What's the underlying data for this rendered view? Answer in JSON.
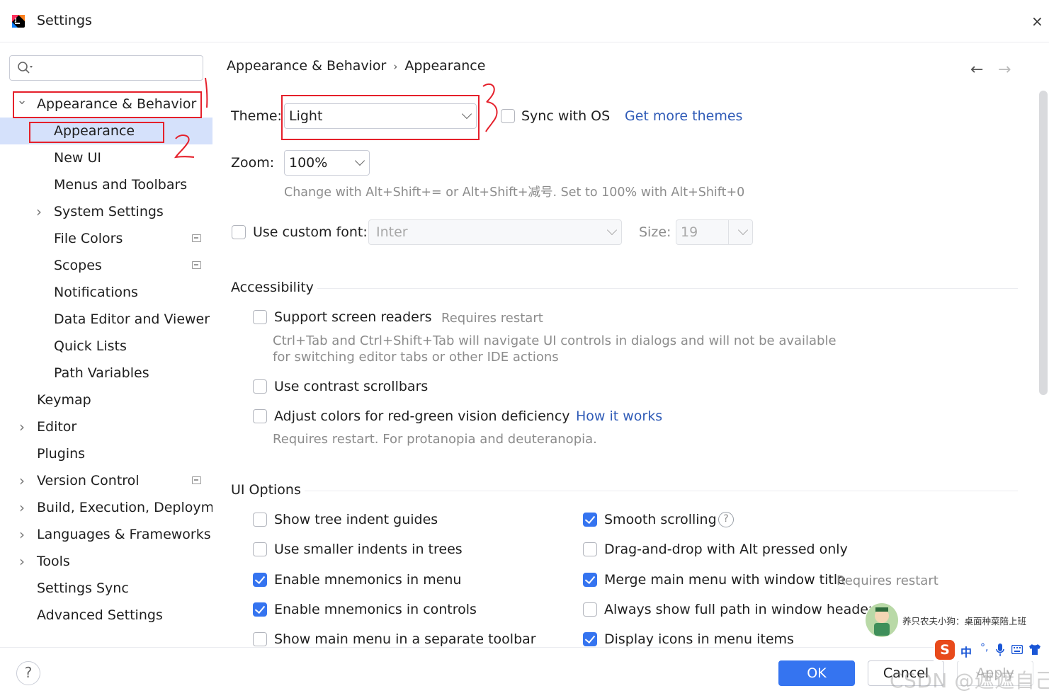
{
  "window": {
    "title": "Settings",
    "close_glyph": "×"
  },
  "sidebar": {
    "search_placeholder": "",
    "items": [
      {
        "label": "Appearance & Behavior",
        "level": 0,
        "expandable": true,
        "expanded": true
      },
      {
        "label": "Appearance",
        "level": 1,
        "selected": true
      },
      {
        "label": "New UI",
        "level": 1
      },
      {
        "label": "Menus and Toolbars",
        "level": 1
      },
      {
        "label": "System Settings",
        "level": 1,
        "expandable": true
      },
      {
        "label": "File Colors",
        "level": 1,
        "badge": true
      },
      {
        "label": "Scopes",
        "level": 1,
        "badge": true
      },
      {
        "label": "Notifications",
        "level": 1
      },
      {
        "label": "Data Editor and Viewer",
        "level": 1
      },
      {
        "label": "Quick Lists",
        "level": 1
      },
      {
        "label": "Path Variables",
        "level": 1
      },
      {
        "label": "Keymap",
        "level": 0
      },
      {
        "label": "Editor",
        "level": 0,
        "expandable": true
      },
      {
        "label": "Plugins",
        "level": 0
      },
      {
        "label": "Version Control",
        "level": 0,
        "expandable": true,
        "badge": true
      },
      {
        "label": "Build, Execution, Deployment",
        "level": 0,
        "expandable": true
      },
      {
        "label": "Languages & Frameworks",
        "level": 0,
        "expandable": true
      },
      {
        "label": "Tools",
        "level": 0,
        "expandable": true
      },
      {
        "label": "Settings Sync",
        "level": 0
      },
      {
        "label": "Advanced Settings",
        "level": 0
      }
    ]
  },
  "breadcrumb": {
    "parent": "Appearance & Behavior",
    "separator": "›",
    "current": "Appearance"
  },
  "nav": {
    "back": "←",
    "forward": "→"
  },
  "theme": {
    "label": "Theme:",
    "value": "Light",
    "sync_label": "Sync with OS",
    "sync_checked": false,
    "more_link": "Get more themes"
  },
  "zoom": {
    "label": "Zoom:",
    "value": "100%",
    "hint": "Change with Alt+Shift+= or Alt+Shift+减号. Set to 100% with Alt+Shift+0"
  },
  "font": {
    "checkbox_label": "Use custom font:",
    "checked": false,
    "font_value": "Inter",
    "size_label": "Size:",
    "size_value": "19"
  },
  "accessibility": {
    "title": "Accessibility",
    "screen_readers": {
      "label": "Support screen readers",
      "note": "Requires restart",
      "checked": false,
      "desc_line1": "Ctrl+Tab and Ctrl+Shift+Tab will navigate UI controls in dialogs and will not be available",
      "desc_line2": "for switching editor tabs or other IDE actions"
    },
    "contrast": {
      "label": "Use contrast scrollbars",
      "checked": false
    },
    "color_deficiency": {
      "label": "Adjust colors for red-green vision deficiency",
      "link": "How it works",
      "checked": false,
      "desc": "Requires restart. For protanopia and deuteranopia."
    }
  },
  "ui_options": {
    "title": "UI Options",
    "left": [
      {
        "label": "Show tree indent guides",
        "checked": false
      },
      {
        "label": "Use smaller indents in trees",
        "checked": false
      },
      {
        "label": "Enable mnemonics in menu",
        "checked": true
      },
      {
        "label": "Enable mnemonics in controls",
        "checked": true
      },
      {
        "label": "Show main menu in a separate toolbar",
        "checked": false
      }
    ],
    "right": [
      {
        "label": "Smooth scrolling",
        "checked": true,
        "help": "?"
      },
      {
        "label": "Drag-and-drop with Alt pressed only",
        "checked": false
      },
      {
        "label": "Merge main menu with window title",
        "checked": true,
        "note": "Requires restart"
      },
      {
        "label": "Always show full path in window header",
        "checked": false
      },
      {
        "label": "Display icons in menu items",
        "checked": true
      }
    ]
  },
  "footer": {
    "help": "?",
    "ok": "OK",
    "cancel": "Cancel",
    "apply": "Apply"
  },
  "overlay": {
    "chat_text": "养只农夫小狗：桌面种菜陪上班",
    "watermark": "CSDN @遮遮自己",
    "ime": {
      "logo": "S",
      "lang": "中"
    }
  },
  "colors": {
    "accent": "#3574f0",
    "selection": "#d5e1fb",
    "link": "#2f5bb7",
    "annotation": "#e5202b"
  }
}
